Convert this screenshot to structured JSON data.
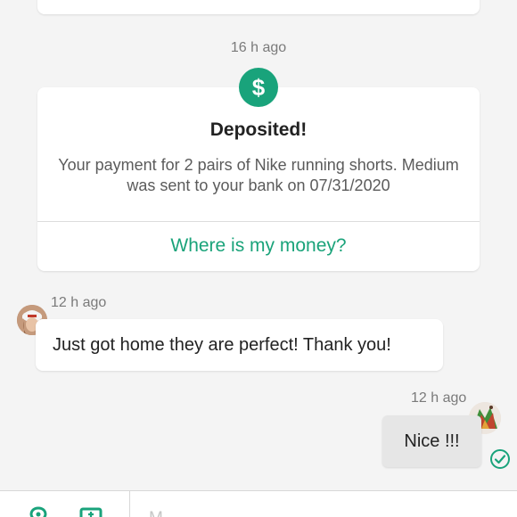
{
  "feed": {
    "deposit_timestamp": "16 h ago",
    "deposit_card": {
      "icon": "dollar-icon",
      "icon_glyph": "$",
      "title": "Deposited!",
      "message": "Your payment for 2 pairs of Nike running shorts. Medium was sent to your bank on 07/31/2020",
      "link_label": "Where is my money?",
      "accent_color": "#19a37b"
    },
    "incoming_message": {
      "timestamp": "12 h ago",
      "text": "Just got home they are perfect! Thank you!"
    },
    "outgoing_message": {
      "timestamp": "12 h ago",
      "text": "Nice !!!",
      "status_icon": "check-circle-icon"
    }
  },
  "composer": {
    "icons": [
      "location-pin-icon",
      "offer-tag-icon"
    ],
    "placeholder": "M"
  }
}
